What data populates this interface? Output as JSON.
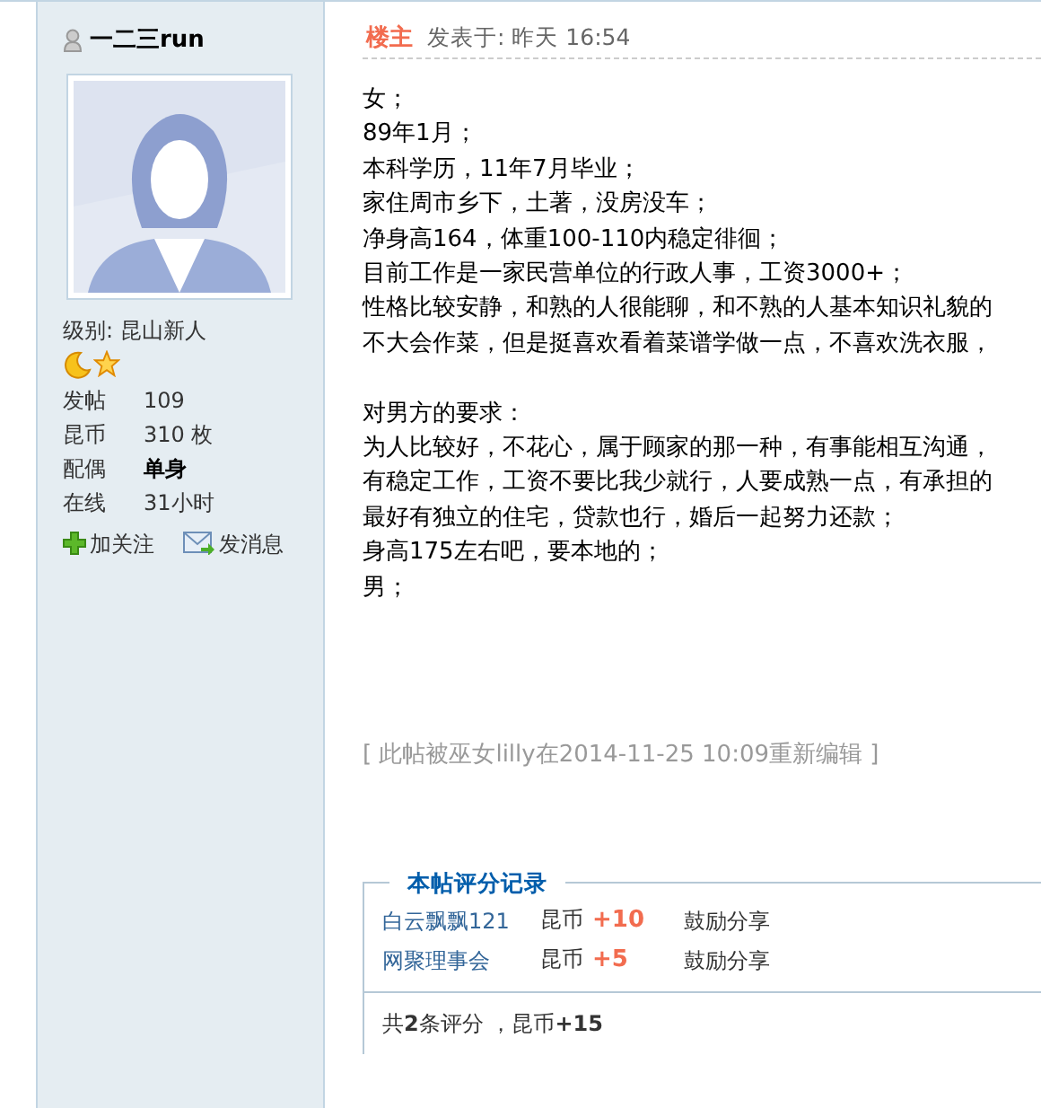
{
  "author": {
    "name": "一二三run",
    "level_label": "级别: 昆山新人",
    "stats": [
      {
        "label": "发帖",
        "value": "109",
        "emphasized": false
      },
      {
        "label": "昆币",
        "value": "310 枚",
        "emphasized": false
      },
      {
        "label": "配偶",
        "value": "单身",
        "emphasized": true
      },
      {
        "label": "在线",
        "value": "31小时",
        "emphasized": false
      }
    ],
    "actions": [
      {
        "label": "加关注",
        "kind": "follow"
      },
      {
        "label": "发消息",
        "kind": "message"
      }
    ]
  },
  "post": {
    "floor": "楼主",
    "posted": "发表于: 昨天 16:54",
    "paragraphs": [
      [
        "女；",
        "89年1月；",
        "本科学历，11年7月毕业；",
        "家住周市乡下，土著，没房没车；",
        "净身高164，体重100-110内稳定徘徊；",
        "目前工作是一家民营单位的行政人事，工资3000+；",
        "性格比较安静，和熟的人很能聊，和不熟的人基本知识礼貌的",
        "不大会作菜，但是挺喜欢看着菜谱学做一点，不喜欢洗衣服，"
      ],
      [
        "对男方的要求：",
        "为人比较好，不花心，属于顾家的那一种，有事能相互沟通，",
        "有稳定工作，工资不要比我少就行，人要成熟一点，有承担的",
        "最好有独立的住宅，贷款也行，婚后一起努力还款；",
        "身高175左右吧，要本地的；",
        "男；"
      ]
    ],
    "edit_note": "[ 此帖被巫女lilly在2014-11-25 10:09重新编辑 ]",
    "ratings": {
      "title": "本帖评分记录",
      "rows": [
        {
          "user": "白云飘飘121",
          "currency": "昆币",
          "amount": "+10",
          "reason": "鼓励分享"
        },
        {
          "user": "网聚理事会",
          "currency": "昆币",
          "amount": "+5",
          "reason": "鼓励分享"
        }
      ],
      "summary": "共**2**条评分 ，昆币**+15**"
    }
  }
}
